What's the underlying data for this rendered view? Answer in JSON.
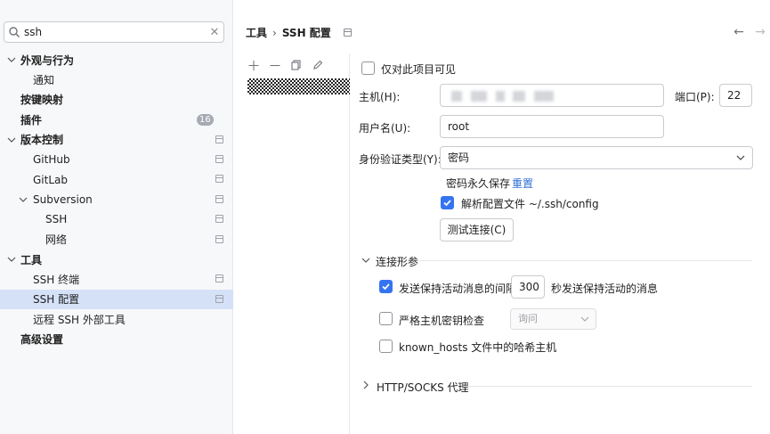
{
  "search": {
    "value": "ssh"
  },
  "tree": [
    {
      "label": "外观与行为",
      "bold": true,
      "chev": "down",
      "level": 0
    },
    {
      "label": "通知",
      "bold": false,
      "level": 1
    },
    {
      "label": "按键映射",
      "bold": true,
      "level": 0
    },
    {
      "label": "插件",
      "bold": true,
      "level": 0,
      "badge": "16"
    },
    {
      "label": "版本控制",
      "bold": true,
      "chev": "down",
      "level": 0,
      "proj": true
    },
    {
      "label": "GitHub",
      "bold": false,
      "level": 1,
      "proj": true
    },
    {
      "label": "GitLab",
      "bold": false,
      "level": 1,
      "proj": true
    },
    {
      "label": "Subversion",
      "bold": false,
      "chev": "down",
      "level": 1,
      "proj": true
    },
    {
      "label": "SSH",
      "bold": false,
      "level": 2,
      "proj": true
    },
    {
      "label": "网络",
      "bold": false,
      "level": 2,
      "proj": true
    },
    {
      "label": "工具",
      "bold": true,
      "chev": "down",
      "level": 0
    },
    {
      "label": "SSH 终端",
      "bold": false,
      "level": 1,
      "proj": true
    },
    {
      "label": "SSH 配置",
      "bold": false,
      "level": 1,
      "proj": true,
      "selected": true
    },
    {
      "label": "远程 SSH 外部工具",
      "bold": false,
      "level": 1
    },
    {
      "label": "高级设置",
      "bold": true,
      "level": 0
    }
  ],
  "breadcrumb": {
    "parent": "工具",
    "separator": "›",
    "current": "SSH 配置"
  },
  "form": {
    "project_only": "仅对此项目可见",
    "host_label": "主机(H):",
    "host_mnemonic": "H",
    "port_label": "端口(P):",
    "port_mnemonic": "P",
    "port_value": "22",
    "username_label": "用户名(U):",
    "username_mnemonic": "U",
    "username_value": "root",
    "auth_label": "身份验证类型(Y):",
    "auth_mnemonic": "Y",
    "auth_value": "密码",
    "password_saved": "密码永久保存",
    "reset_link": "重置",
    "parse_config": "解析配置文件 ~/.ssh/config",
    "test_button": "测试连接(C)",
    "conn_params": "连接形参",
    "keepalive_label": "发送保持活动消息的间隔:",
    "keepalive_value": "300",
    "keepalive_unit": "秒发送保持活动的消息",
    "strict_host_label": "严格主机密钥检查",
    "strict_host_value": "询问",
    "known_hosts_label": "known_hosts 文件中的哈希主机",
    "proxy_section": "HTTP/SOCKS 代理"
  },
  "colors": {
    "accent": "#3574f0",
    "selected_row": "#d5e1f7",
    "link": "#2f6fd6"
  }
}
